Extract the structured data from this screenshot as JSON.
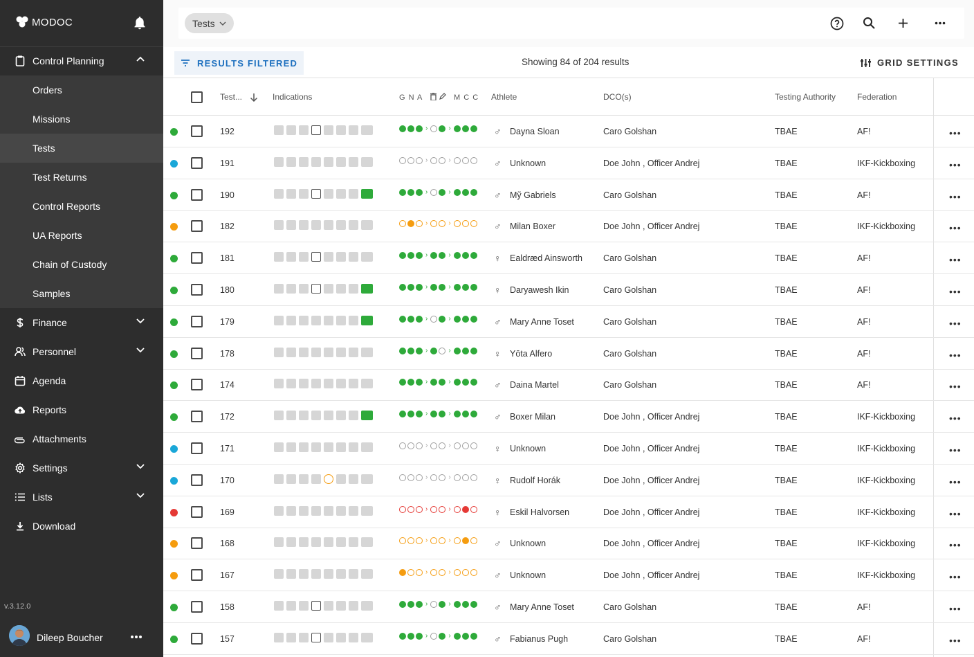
{
  "app": {
    "brand": "MODOC",
    "version": "v.3.12.0"
  },
  "user": {
    "name": "Dileep Boucher"
  },
  "nav": [
    {
      "label": "Control Planning",
      "icon": "clipboard-icon",
      "expandable": true,
      "expanded": true
    },
    {
      "label": "Orders",
      "sub": true
    },
    {
      "label": "Missions",
      "sub": true
    },
    {
      "label": "Tests",
      "sub": true,
      "active": true
    },
    {
      "label": "Test Returns",
      "sub": true
    },
    {
      "label": "Control Reports",
      "sub": true
    },
    {
      "label": "UA Reports",
      "sub": true
    },
    {
      "label": "Chain of Custody",
      "sub": true
    },
    {
      "label": "Samples",
      "sub": true
    },
    {
      "label": "Finance",
      "icon": "dollar-icon",
      "expandable": true
    },
    {
      "label": "Personnel",
      "icon": "people-icon",
      "expandable": true
    },
    {
      "label": "Agenda",
      "icon": "calendar-icon"
    },
    {
      "label": "Reports",
      "icon": "cloud-upload-icon"
    },
    {
      "label": "Attachments",
      "icon": "paperclip-icon"
    },
    {
      "label": "Settings",
      "icon": "gear-icon",
      "expandable": true
    },
    {
      "label": "Lists",
      "icon": "list-icon",
      "expandable": true
    },
    {
      "label": "Download",
      "icon": "download-icon"
    }
  ],
  "topbar": {
    "crumb": "Tests"
  },
  "toolbar": {
    "filtered_label": "RESULTS FILTERED",
    "showing": "Showing 84 of 204 results",
    "grid_settings": "GRID SETTINGS"
  },
  "columns": {
    "test": "Test...",
    "indications": "Indications",
    "gna": "G N A",
    "mcc": "M C C",
    "athlete": "Athlete",
    "dco": "DCO(s)",
    "authority": "Testing Authority",
    "federation": "Federation"
  },
  "colors": {
    "green": "#2eaa3a",
    "blue": "#1aa7d8",
    "orange": "#f59c0f",
    "red": "#e53935",
    "accent": "#1e70bf"
  },
  "rows": [
    {
      "status": "green",
      "id": "192",
      "gender": "male",
      "athlete": "Dayna Sloan",
      "dco": "Caro Golshan",
      "authority": "TBAE",
      "federation": "AF!",
      "cal": true,
      "truck": false,
      "g": [
        "g",
        "g",
        "g"
      ],
      "n": [
        "o",
        "g"
      ],
      "a": [
        "g",
        "g",
        "g"
      ]
    },
    {
      "status": "blue",
      "id": "191",
      "gender": "male",
      "athlete": "Unknown",
      "dco": "Doe John , Officer Andrej",
      "authority": "TBAE",
      "federation": "IKF-Kickboxing",
      "cal": false,
      "truck": false,
      "g": [
        "o",
        "o",
        "o"
      ],
      "n": [
        "o",
        "o"
      ],
      "a": [
        "o",
        "o",
        "o"
      ]
    },
    {
      "status": "green",
      "id": "190",
      "gender": "male",
      "athlete": "Mỹ Gabriels",
      "dco": "Caro Golshan",
      "authority": "TBAE",
      "federation": "AF!",
      "cal": true,
      "truck": true,
      "g": [
        "g",
        "g",
        "g"
      ],
      "n": [
        "o",
        "g"
      ],
      "a": [
        "g",
        "g",
        "g"
      ]
    },
    {
      "status": "orange",
      "id": "182",
      "gender": "male",
      "athlete": "Milan Boxer",
      "dco": "Doe John , Officer Andrej",
      "authority": "TBAE",
      "federation": "IKF-Kickboxing",
      "cal": false,
      "truck": false,
      "g": [
        "oo",
        "oy",
        "oo"
      ],
      "n": [
        "oo",
        "oo"
      ],
      "a": [
        "oo",
        "oo",
        "oo"
      ]
    },
    {
      "status": "green",
      "id": "181",
      "gender": "female",
      "athlete": "Ealdræd Ainsworth",
      "dco": "Caro Golshan",
      "authority": "TBAE",
      "federation": "AF!",
      "cal": true,
      "truck": false,
      "g": [
        "g",
        "g",
        "g"
      ],
      "n": [
        "g",
        "g"
      ],
      "a": [
        "g",
        "g",
        "g"
      ]
    },
    {
      "status": "green",
      "id": "180",
      "gender": "female",
      "athlete": "Daryawesh Ikin",
      "dco": "Caro Golshan",
      "authority": "TBAE",
      "federation": "AF!",
      "cal": true,
      "truck": true,
      "g": [
        "g",
        "g",
        "g"
      ],
      "n": [
        "g",
        "g"
      ],
      "a": [
        "g",
        "g",
        "g"
      ]
    },
    {
      "status": "green",
      "id": "179",
      "gender": "male",
      "athlete": "Mary Anne Toset",
      "dco": "Caro Golshan",
      "authority": "TBAE",
      "federation": "AF!",
      "cal": false,
      "truck": true,
      "g": [
        "g",
        "g",
        "g"
      ],
      "n": [
        "o",
        "g"
      ],
      "a": [
        "g",
        "g",
        "g"
      ]
    },
    {
      "status": "green",
      "id": "178",
      "gender": "female",
      "athlete": "Yōta Alfero",
      "dco": "Caro Golshan",
      "authority": "TBAE",
      "federation": "AF!",
      "cal": false,
      "truck": false,
      "g": [
        "g",
        "g",
        "g"
      ],
      "n": [
        "g",
        "o"
      ],
      "a": [
        "g",
        "g",
        "g"
      ]
    },
    {
      "status": "green",
      "id": "174",
      "gender": "male",
      "athlete": "Daina Martel",
      "dco": "Caro Golshan",
      "authority": "TBAE",
      "federation": "AF!",
      "cal": false,
      "truck": false,
      "g": [
        "g",
        "g",
        "g"
      ],
      "n": [
        "g",
        "g"
      ],
      "a": [
        "g",
        "g",
        "g"
      ]
    },
    {
      "status": "green",
      "id": "172",
      "gender": "male",
      "athlete": "Boxer Milan",
      "dco": "Doe John , Officer Andrej",
      "authority": "TBAE",
      "federation": "IKF-Kickboxing",
      "cal": false,
      "truck": true,
      "g": [
        "g",
        "g",
        "g"
      ],
      "n": [
        "g",
        "g"
      ],
      "a": [
        "g",
        "g",
        "g"
      ]
    },
    {
      "status": "blue",
      "id": "171",
      "gender": "female",
      "athlete": "Unknown",
      "dco": "Doe John , Officer Andrej",
      "authority": "TBAE",
      "federation": "IKF-Kickboxing",
      "cal": false,
      "truck": false,
      "g": [
        "o",
        "o",
        "o"
      ],
      "n": [
        "o",
        "o"
      ],
      "a": [
        "o",
        "o",
        "o"
      ]
    },
    {
      "status": "blue",
      "id": "170",
      "gender": "female",
      "athlete": "Rudolf Horák",
      "dco": "Doe John , Officer Andrej",
      "authority": "TBAE",
      "federation": "IKF-Kickboxing",
      "cal": false,
      "truck": false,
      "clock": true,
      "g": [
        "o",
        "o",
        "o"
      ],
      "n": [
        "o",
        "o"
      ],
      "a": [
        "o",
        "o",
        "o"
      ]
    },
    {
      "status": "red",
      "id": "169",
      "gender": "female",
      "athlete": "Eskil Halvorsen",
      "dco": "Doe John , Officer Andrej",
      "authority": "TBAE",
      "federation": "IKF-Kickboxing",
      "cal": false,
      "truck": false,
      "g": [
        "ro",
        "ro",
        "ro"
      ],
      "n": [
        "ro",
        "ro"
      ],
      "a": [
        "ro",
        "r",
        "ro"
      ]
    },
    {
      "status": "orange",
      "id": "168",
      "gender": "male",
      "athlete": "Unknown",
      "dco": "Doe John , Officer Andrej",
      "authority": "TBAE",
      "federation": "IKF-Kickboxing",
      "cal": false,
      "truck": false,
      "g": [
        "oo",
        "oo",
        "oo"
      ],
      "n": [
        "oo",
        "oo"
      ],
      "a": [
        "oo",
        "oy",
        "oo"
      ]
    },
    {
      "status": "orange",
      "id": "167",
      "gender": "male",
      "athlete": "Unknown",
      "dco": "Doe John , Officer Andrej",
      "authority": "TBAE",
      "federation": "IKF-Kickboxing",
      "cal": false,
      "truck": false,
      "g": [
        "oy",
        "oo",
        "oo"
      ],
      "n": [
        "oo",
        "oo"
      ],
      "a": [
        "oo",
        "oo",
        "oo"
      ]
    },
    {
      "status": "green",
      "id": "158",
      "gender": "male",
      "athlete": "Mary Anne Toset",
      "dco": "Caro Golshan",
      "authority": "TBAE",
      "federation": "AF!",
      "cal": true,
      "truck": false,
      "g": [
        "g",
        "g",
        "g"
      ],
      "n": [
        "o",
        "g"
      ],
      "a": [
        "g",
        "g",
        "g"
      ]
    },
    {
      "status": "green",
      "id": "157",
      "gender": "male",
      "athlete": "Fabianus Pugh",
      "dco": "Caro Golshan",
      "authority": "TBAE",
      "federation": "AF!",
      "cal": true,
      "truck": false,
      "g": [
        "g",
        "g",
        "g"
      ],
      "n": [
        "o",
        "g"
      ],
      "a": [
        "g",
        "g",
        "g"
      ]
    }
  ]
}
